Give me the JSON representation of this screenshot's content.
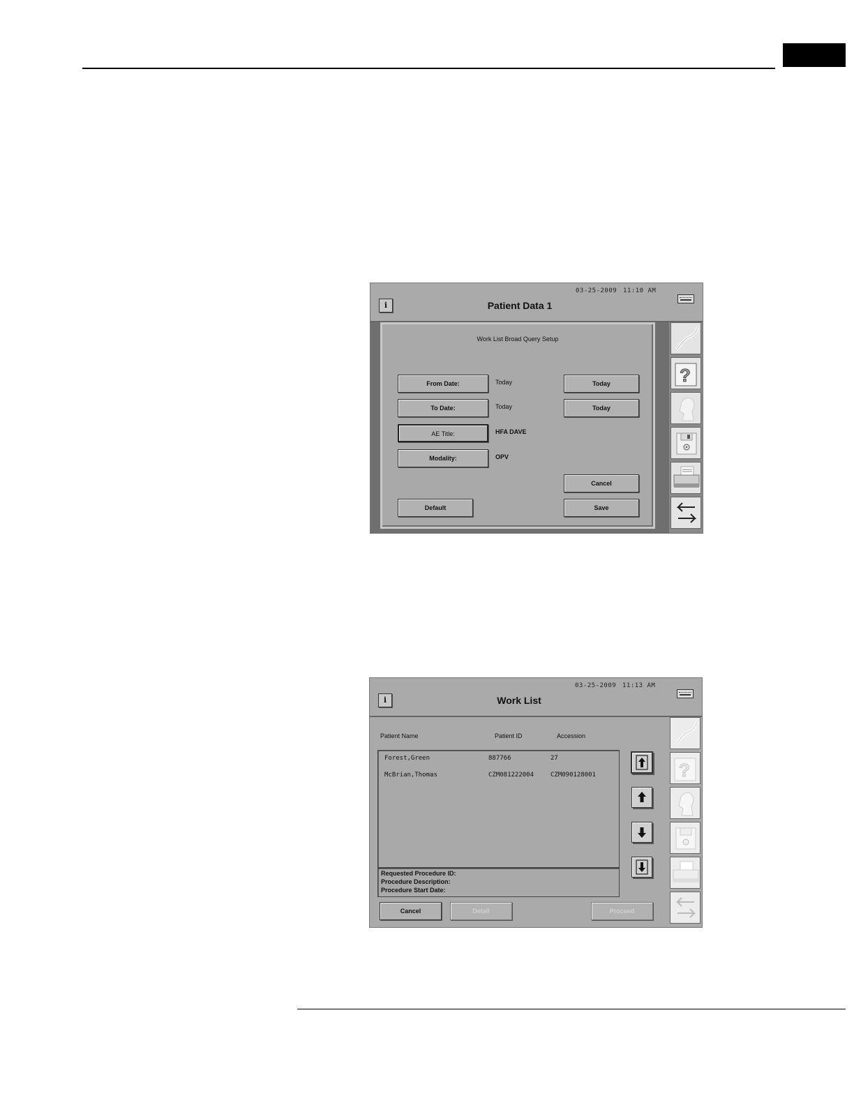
{
  "screen1": {
    "date": "03-25-2009",
    "time": "11:10 AM",
    "title": "Patient Data 1",
    "dialog_title": "Work List Broad Query Setup",
    "fields": [
      {
        "label": "From Date:",
        "value": "Today",
        "right_button": "Today"
      },
      {
        "label": "To Date:",
        "value": "Today",
        "right_button": "Today"
      },
      {
        "label": "AE Title:",
        "value": "HFA DAVE"
      },
      {
        "label": "Modality:",
        "value": "OPV"
      }
    ],
    "cancel": "Cancel",
    "default": "Default",
    "save": "Save"
  },
  "screen2": {
    "date": "03-25-2009",
    "time": "11:13 AM",
    "title": "Work List",
    "columns": [
      "Patient Name",
      "Patient ID",
      "Accession"
    ],
    "rows": [
      [
        "Forest,Green",
        "887766",
        "27"
      ],
      [
        "McBrian,Thomas",
        "CZM081222004",
        "CZM090128001"
      ]
    ],
    "details": [
      "Requested Procedure ID:",
      "Procedure Description:",
      "Procedure Start Date:"
    ],
    "cancel": "Cancel",
    "detail": "Detail",
    "proceed": "Proceed"
  },
  "icons": {
    "info": "info-icon",
    "keyboard": "keyboard-icon",
    "side": [
      "curve-tool-icon",
      "help-icon",
      "patient-profile-icon",
      "floppy-disk-icon",
      "printer-icon",
      "return-arrows-icon"
    ],
    "scroll": [
      "page-up-icon",
      "line-up-icon",
      "line-down-icon",
      "page-down-icon"
    ]
  },
  "info_symbol": "i"
}
